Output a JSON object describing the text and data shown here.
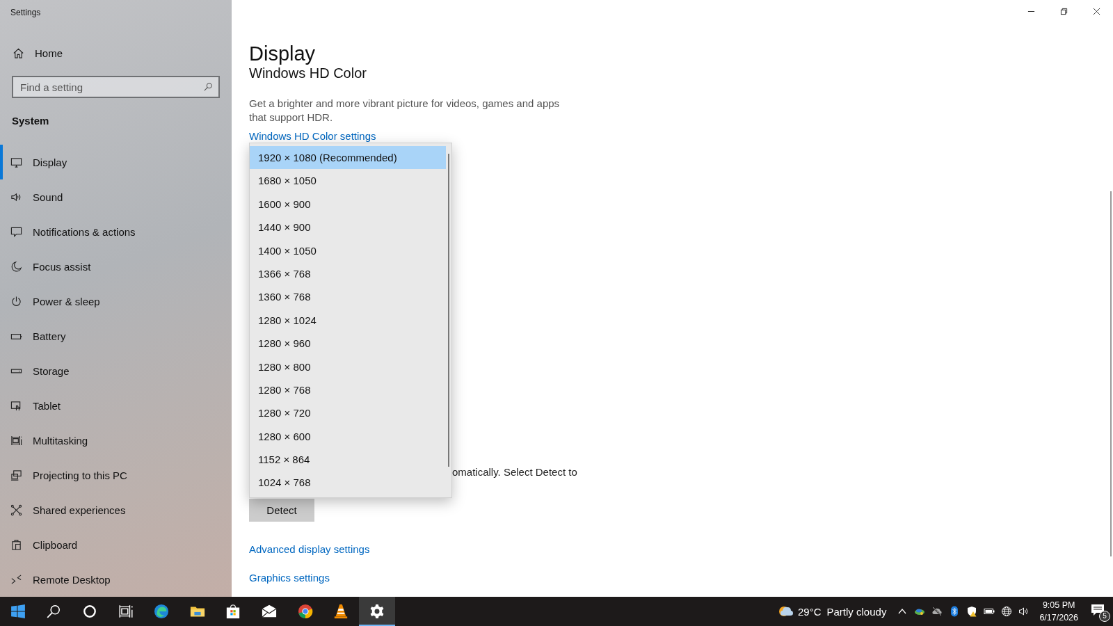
{
  "window": {
    "title": "Settings"
  },
  "sidebar": {
    "home": "Home",
    "search": {
      "placeholder": "Find a setting"
    },
    "section": "System",
    "items": [
      {
        "label": "Display",
        "selected": true
      },
      {
        "label": "Sound",
        "selected": false
      },
      {
        "label": "Notifications & actions",
        "selected": false
      },
      {
        "label": "Focus assist",
        "selected": false
      },
      {
        "label": "Power & sleep",
        "selected": false
      },
      {
        "label": "Battery",
        "selected": false
      },
      {
        "label": "Storage",
        "selected": false
      },
      {
        "label": "Tablet",
        "selected": false
      },
      {
        "label": "Multitasking",
        "selected": false
      },
      {
        "label": "Projecting to this PC",
        "selected": false
      },
      {
        "label": "Shared experiences",
        "selected": false
      },
      {
        "label": "Clipboard",
        "selected": false
      },
      {
        "label": "Remote Desktop",
        "selected": false
      }
    ]
  },
  "main": {
    "title": "Display",
    "heading": "Windows HD Color",
    "description": "Get a brighter and more vibrant picture for videos, games and apps that support HDR.",
    "hdr_link": "Windows HD Color settings",
    "resolution_dropdown": [
      {
        "label": "1920 × 1080 (Recommended)",
        "selected": true
      },
      {
        "label": "1680 × 1050",
        "selected": false
      },
      {
        "label": "1600 × 900",
        "selected": false
      },
      {
        "label": "1440 × 900",
        "selected": false
      },
      {
        "label": "1400 × 1050",
        "selected": false
      },
      {
        "label": "1366 × 768",
        "selected": false
      },
      {
        "label": "1360 × 768",
        "selected": false
      },
      {
        "label": "1280 × 1024",
        "selected": false
      },
      {
        "label": "1280 × 960",
        "selected": false
      },
      {
        "label": "1280 × 800",
        "selected": false
      },
      {
        "label": "1280 × 768",
        "selected": false
      },
      {
        "label": "1280 × 720",
        "selected": false
      },
      {
        "label": "1280 × 600",
        "selected": false
      },
      {
        "label": "1152 × 864",
        "selected": false
      },
      {
        "label": "1024 × 768",
        "selected": false
      }
    ],
    "detect_text": "omatically. Select Detect to",
    "detect_button": "Detect",
    "links": [
      "Advanced display settings",
      "Graphics settings"
    ]
  },
  "taskbar": {
    "apps": [
      {
        "active": false
      },
      {
        "active": false
      },
      {
        "active": false
      },
      {
        "active": false
      },
      {
        "active": false
      },
      {
        "active": false
      },
      {
        "active": false
      },
      {
        "active": false
      },
      {
        "active": false
      },
      {
        "active": false
      },
      {
        "active": true
      }
    ],
    "weather": {
      "temperature": "29°C",
      "condition": "Partly cloudy"
    },
    "time": "9:05 PM",
    "date": "6/17/2026",
    "notifications": "5"
  }
}
